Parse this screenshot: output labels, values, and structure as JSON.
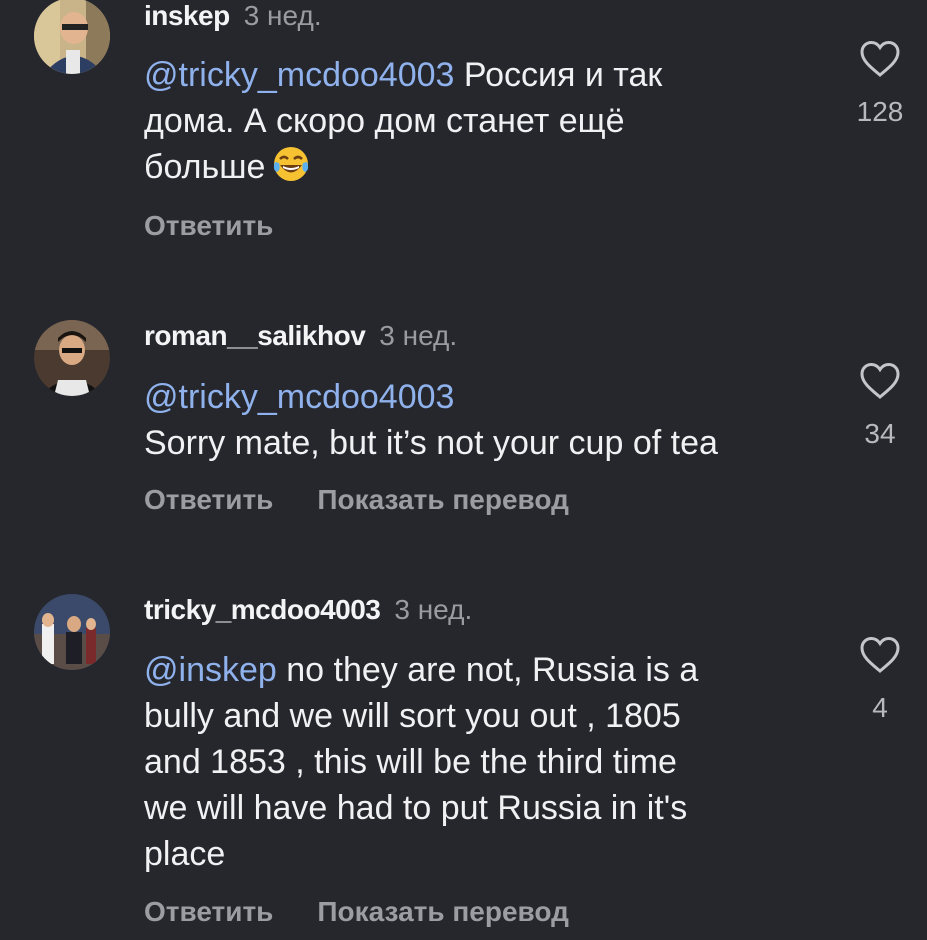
{
  "comments": [
    {
      "username": "inskep",
      "time": "3 нед.",
      "mention": "@tricky_mcdoo4003",
      "text_lines": [
        "Россия и так",
        "дома. А скоро дом станет ещё",
        "больше"
      ],
      "emoji": "face-with-tears-of-joy",
      "like_count": "128",
      "reply_label": "Ответить"
    },
    {
      "username": "roman__salikhov",
      "time": "3 нед.",
      "mention": "@tricky_mcdoo4003",
      "text_lines": [
        "Sorry mate, but it’s not your cup of tea"
      ],
      "like_count": "34",
      "reply_label": "Ответить",
      "translate_label": "Показать перевод"
    },
    {
      "username": "tricky_mcdoo4003",
      "time": "3 нед.",
      "mention": "@inskep",
      "text_lines": [
        "no they are not, Russia is a",
        "bully and we will sort you out , 1805",
        "and 1853 , this will be the third time",
        "we will have had to put Russia in it's",
        "place"
      ],
      "like_count": "4",
      "reply_label": "Ответить",
      "translate_label": "Показать перевод"
    }
  ],
  "colors": {
    "background": "#26272d",
    "mention": "#8fb1ec",
    "secondary_text": "#9c9da3"
  }
}
